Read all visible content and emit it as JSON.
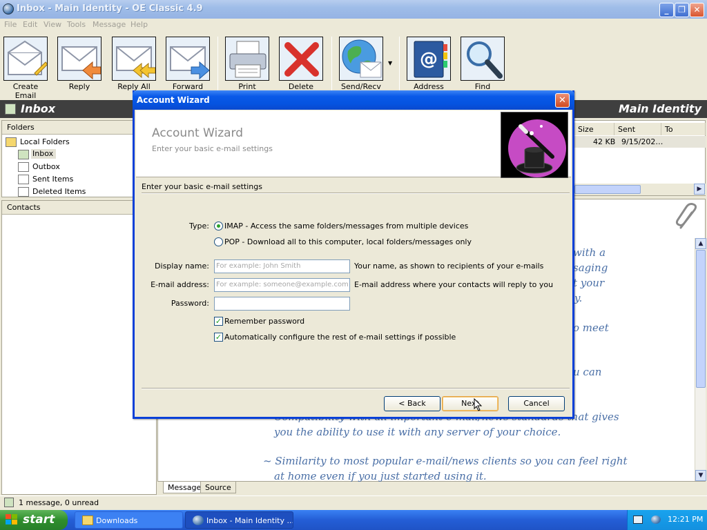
{
  "window": {
    "title": "Inbox - Main Identity - OE Classic 4.9"
  },
  "menu": [
    "File",
    "Edit",
    "View",
    "Tools",
    "Message",
    "Help"
  ],
  "toolbar": {
    "create_email": "Create Email",
    "reply": "Reply",
    "reply_all": "Reply All",
    "forward": "Forward",
    "print": "Print",
    "delete": "Delete",
    "send_recv": "Send/Recv",
    "address_book": "Address Book",
    "find": "Find"
  },
  "header": {
    "folder_title": "Inbox",
    "identity": "Main Identity"
  },
  "folders": {
    "heading": "Folders",
    "items": [
      {
        "label": "Local Folders"
      },
      {
        "label": "Inbox"
      },
      {
        "label": "Outbox"
      },
      {
        "label": "Sent Items"
      },
      {
        "label": "Deleted Items"
      }
    ]
  },
  "contacts": {
    "heading": "Contacts"
  },
  "message_list": {
    "columns": [
      "Size",
      "Sent",
      "To"
    ],
    "rows": [
      {
        "size": "42 KB",
        "sent": "9/15/202…",
        "to": ""
      }
    ]
  },
  "preview": {
    "right_fragments": [
      "with  a",
      "saging",
      "t  your",
      "y.",
      "o meet",
      "u  can"
    ],
    "lines": [
      "Compatibility with all important e-mail/news standards that gives",
      "you the ability to use it with any server of your choice.",
      "~ Similarity to most popular e-mail/news clients so you can feel right",
      "at home even if you just started using it."
    ]
  },
  "tabs": {
    "message": "Message",
    "source": "Source"
  },
  "status": {
    "text": "1 message, 0 unread"
  },
  "dialog": {
    "title": "Account Wizard",
    "heading": "Account Wizard",
    "subheading": "Enter your basic e-mail settings",
    "section_label": "Enter your basic e-mail settings",
    "type_label": "Type:",
    "imap_option": "IMAP - Access the same folders/messages from multiple devices",
    "pop_option": "POP - Download all to this computer, local folders/messages only",
    "selected_type": "IMAP",
    "display_name_label": "Display name:",
    "display_name_placeholder": "For example: John Smith",
    "display_name_hint": "Your name, as shown to recipients of your e-mails",
    "email_label": "E-mail address:",
    "email_placeholder": "For example: someone@example.com",
    "email_hint": "E-mail address where your contacts will reply to you",
    "password_label": "Password:",
    "password_value": "",
    "remember_password": "Remember password",
    "remember_checked": true,
    "auto_configure": "Automatically configure the rest of e-mail settings if possible",
    "auto_checked": true,
    "back_button": "< Back",
    "next_button": "Next",
    "cancel_button": "Cancel"
  },
  "taskbar": {
    "start_label": "start",
    "tasks": [
      {
        "label": "Downloads",
        "icon": "folder-icon"
      },
      {
        "label": "Inbox - Main Identity ...",
        "icon": "oe-classic-icon"
      }
    ],
    "clock": "12:21 PM"
  },
  "colors": {
    "xp_title_blue": "#0553e0",
    "inactive_title": "#9fbde8",
    "taskbar_blue": "#245ed6",
    "start_green": "#2f8e2c",
    "preview_text": "#4a6fa6",
    "inbox_strip": "#3f3f3f"
  }
}
